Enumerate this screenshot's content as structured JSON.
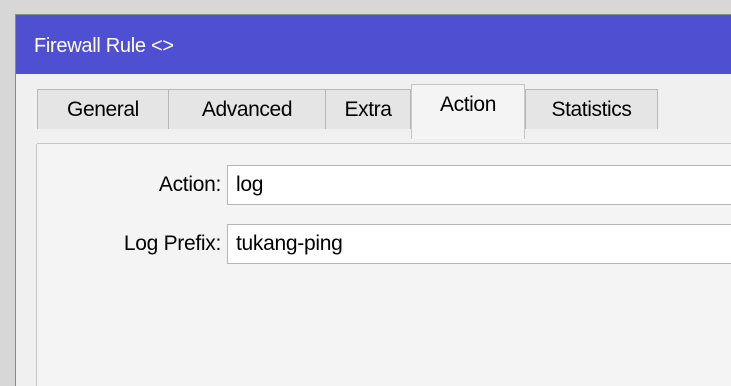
{
  "window": {
    "title": "Firewall Rule <>"
  },
  "tabs": [
    {
      "label": "General",
      "active": false
    },
    {
      "label": "Advanced",
      "active": false
    },
    {
      "label": "Extra",
      "active": false
    },
    {
      "label": "Action",
      "active": true
    },
    {
      "label": "Statistics",
      "active": false
    }
  ],
  "form": {
    "action": {
      "label": "Action:",
      "value": "log"
    },
    "log_prefix": {
      "label": "Log Prefix:",
      "value": "tukang-ping"
    }
  },
  "colors": {
    "titlebar": "#4f4fd2",
    "window_bg": "#f0f0f0",
    "input_bg": "#ffffff"
  }
}
